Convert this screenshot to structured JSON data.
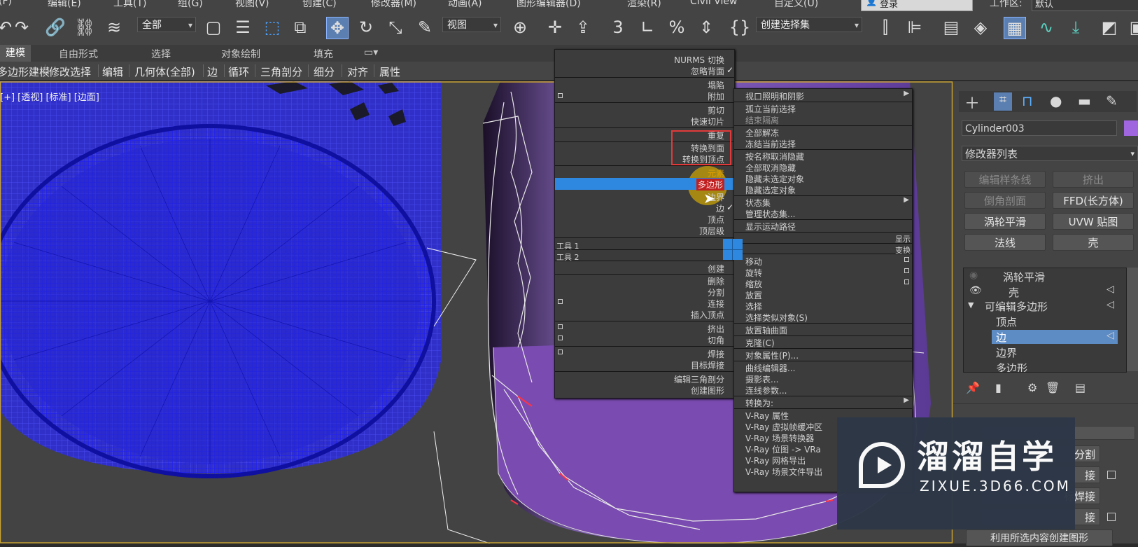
{
  "menubar": {
    "items": [
      "(F)",
      "编辑(E)",
      "工具(T)",
      "组(G)",
      "视图(V)",
      "创建(C)",
      "修改器(M)",
      "动画(A)",
      "图形编辑器(D)",
      "渲染(R)",
      "Civil View",
      "自定义(U)",
      "登录",
      "工作区:",
      "默认"
    ]
  },
  "toolbar": {
    "filter": "全部",
    "coord": "视图",
    "selection_set": "创建选择集",
    "active_color": "#5a7fb0",
    "icons": [
      "undo-icon",
      "redo-icon",
      "link-icon",
      "unlink-icon",
      "bind-spacewarp-icon",
      "select-icon",
      "select-by-name-icon",
      "rect-region-icon",
      "window-crossing-icon",
      "move-icon",
      "rotate-icon",
      "scale-icon",
      "place-icon",
      "keyboard-shortcut-icon",
      "snap-3-icon",
      "angle-snap-icon",
      "percent-snap-icon",
      "spinner-snap-icon",
      "edit-named-sets-icon",
      "mirror-icon",
      "align-icon",
      "layer-explorer-icon",
      "scene-explorer-icon",
      "ribbon-icon",
      "curve-editor-icon",
      "schematic-icon",
      "material-editor-icon"
    ]
  },
  "ribbon": {
    "tabs": [
      "建模",
      "自由形式",
      "选择",
      "对象绘制",
      "填充"
    ],
    "buttons": [
      "多边形建模",
      "修改选择",
      "编辑",
      "几何体(全部)",
      "边",
      "循环",
      "三角剖分",
      "细分",
      "对齐",
      "属性"
    ]
  },
  "viewport": {
    "label": "[+] [透视] [标准] [边面]",
    "mesh_color": "#1a1ae6",
    "object_color": "#7a4bb0"
  },
  "quad_left": {
    "items": [
      "NURMS 切换",
      "忽略背面",
      "塌陷",
      "附加",
      "剪切",
      "快速切片",
      "重复",
      "转换到面",
      "转换到顶点",
      "元素",
      "多边形",
      "边界",
      "边",
      "顶点",
      "顶层级",
      "工具 1",
      "工具 2",
      "创建",
      "删除",
      "分割",
      "连接",
      "插入顶点",
      "挤出",
      "切角",
      "焊接",
      "目标焊接",
      "编辑三角剖分",
      "创建图形"
    ]
  },
  "quad_right": {
    "items": [
      "视口照明和阴影",
      "孤立当前选择",
      "结束隔离",
      "全部解冻",
      "冻结当前选择",
      "按名称取消隐藏",
      "全部取消隐藏",
      "隐藏未选定对象",
      "隐藏选定对象",
      "状态集",
      "管理状态集...",
      "显示运动路径",
      "显示",
      "变换",
      "移动",
      "旋转",
      "缩放",
      "放置",
      "选择",
      "选择类似对象(S)",
      "放置轴曲面",
      "克隆(C)",
      "对象属性(P)...",
      "曲线编辑器...",
      "摄影表...",
      "连线参数...",
      "转换为:",
      "V-Ray 属性",
      "V-Ray 虚拟帧缓冲区",
      "V-Ray 场景转换器",
      "V-Ray 位图 -> VRa",
      "V-Ray 网格导出",
      "V-Ray 场景文件导出"
    ]
  },
  "command_panel": {
    "object_name": "Cylinder003",
    "object_color": "#a066e0",
    "modifier_list": "修改器列表",
    "buttons": [
      "编辑样条线",
      "挤出",
      "倒角剖面",
      "FFD(长方体)",
      "涡轮平滑",
      "UVW 贴图",
      "法线",
      "壳"
    ],
    "stack": [
      "涡轮平滑",
      "壳",
      "可编辑多边形",
      "顶点",
      "边",
      "边界",
      "多边形"
    ],
    "lower_buttons": [
      "分割",
      "接",
      "标焊接",
      "接",
      "利用所选内容创建图形"
    ]
  },
  "watermark": {
    "brand": "溜溜自学",
    "url": "ZIXUE.3D66.COM"
  }
}
